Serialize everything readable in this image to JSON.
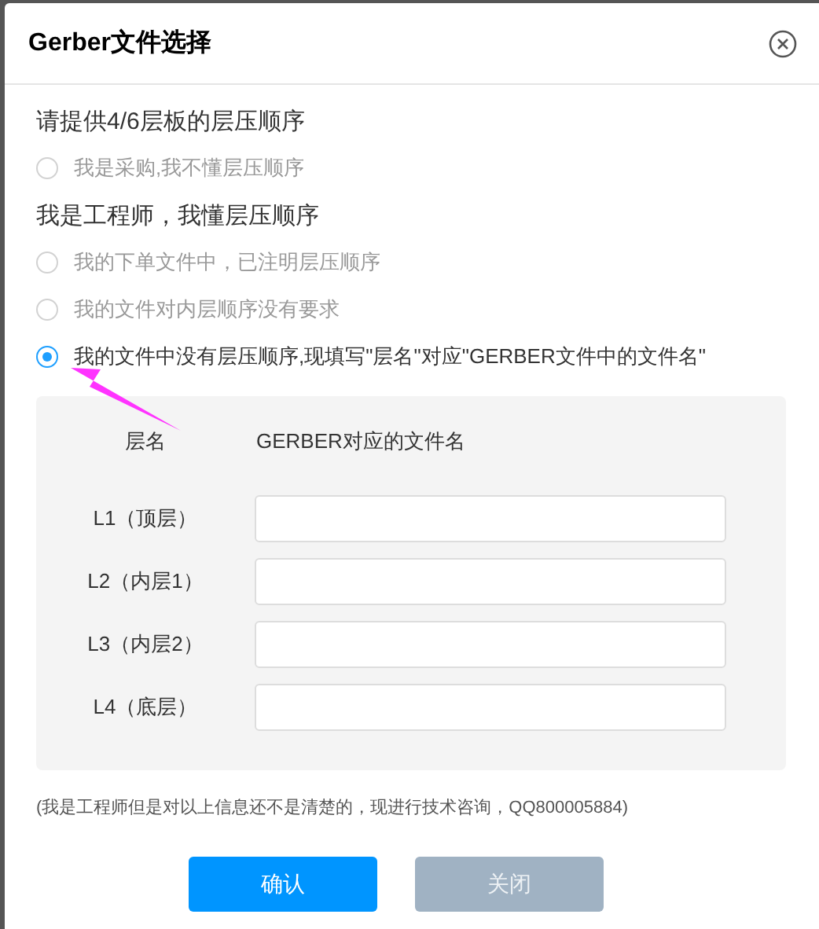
{
  "dialog": {
    "title": "Gerber文件选择"
  },
  "sections": [
    {
      "heading": "请提供4/6层板的层压顺序",
      "options": [
        {
          "label": "我是采购,我不懂层压顺序",
          "selected": false
        }
      ]
    },
    {
      "heading": "我是工程师，我懂层压顺序",
      "options": [
        {
          "label": "我的下单文件中，已注明层压顺序",
          "selected": false
        },
        {
          "label": "我的文件对内层顺序没有要求",
          "selected": false
        },
        {
          "label": "我的文件中没有层压顺序,现填写\"层名\"对应\"GERBER文件中的文件名\"",
          "selected": true
        }
      ]
    }
  ],
  "layer_table": {
    "columns": [
      "层名",
      "GERBER对应的文件名"
    ],
    "rows": [
      {
        "layer": "L1（顶层）"
      },
      {
        "layer": "L2（内层1）"
      },
      {
        "layer": "L3（内层2）"
      },
      {
        "layer": "L4（底层）"
      }
    ]
  },
  "note": "(我是工程师但是对以上信息还不是清楚的，现进行技术咨询，QQ800005884)",
  "buttons": [
    {
      "label": "确认",
      "kind": "primary"
    },
    {
      "label": "关闭",
      "kind": "secondary"
    }
  ]
}
